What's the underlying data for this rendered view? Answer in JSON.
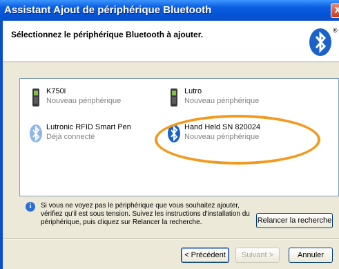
{
  "window": {
    "title": "Assistant Ajout de périphérique Bluetooth",
    "close_glyph": "X"
  },
  "header": {
    "heading": "Sélectionnez le périphérique Bluetooth à ajouter.",
    "logo_icon": "bluetooth-logo-icon",
    "registered_mark": "®"
  },
  "devices": [
    {
      "name": "K750i",
      "status": "Nouveau périphérique",
      "icon": "mobile-phone-icon"
    },
    {
      "name": "Lutro",
      "status": "Nouveau périphérique",
      "icon": "mobile-phone-icon"
    },
    {
      "name": "Lutronic RFID Smart Pen",
      "status": "Déjà connecté",
      "icon": "bluetooth-icon"
    },
    {
      "name": "Hand Held SN 820024",
      "status": "Nouveau périphérique",
      "icon": "bluetooth-icon"
    }
  ],
  "info": {
    "text": "Si vous ne voyez pas le périphérique que vous souhaitez ajouter, vérifiez qu'il est sous tension. Suivez les instructions d'installation du périphérique, puis cliquez sur Relancer la recherche.",
    "icon": "info-icon",
    "icon_glyph": "i"
  },
  "buttons": {
    "search_again": "Relancer la recherche",
    "back": "< Précédent",
    "next": "Suivant >",
    "cancel": "Annuler"
  },
  "colors": {
    "highlight_oval": "#f29a1d",
    "titlebar": "#0553d6"
  }
}
